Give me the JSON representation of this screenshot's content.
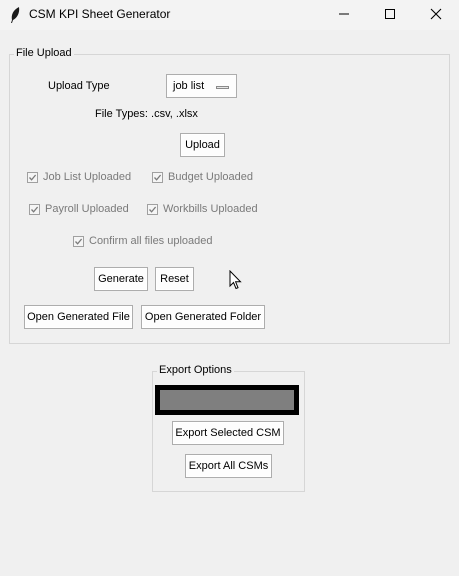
{
  "window": {
    "title": "CSM KPI Sheet Generator",
    "minimize_icon": "minimize-icon",
    "maximize_icon": "maximize-icon",
    "close_icon": "close-icon",
    "app_icon": "feather-icon"
  },
  "file_upload": {
    "frame_label": "File Upload",
    "upload_type_label": "Upload Type",
    "upload_type_value": "job list",
    "file_types_text": "File Types: .csv, .xlsx",
    "upload_button": "Upload",
    "checkboxes": {
      "job_list": {
        "label": "Job List Uploaded",
        "checked": true,
        "disabled": true
      },
      "budget": {
        "label": "Budget Uploaded",
        "checked": true,
        "disabled": true
      },
      "payroll": {
        "label": "Payroll Uploaded",
        "checked": true,
        "disabled": true
      },
      "workbills": {
        "label": "Workbills Uploaded",
        "checked": true,
        "disabled": true
      },
      "confirm": {
        "label": "Confirm all files uploaded",
        "checked": true,
        "disabled": true
      }
    },
    "generate_button": "Generate",
    "reset_button": "Reset",
    "open_file_button": "Open Generated File",
    "open_folder_button": "Open Generated Folder"
  },
  "export_options": {
    "frame_label": "Export Options",
    "csm_select_value": "",
    "export_selected_button": "Export Selected CSM",
    "export_all_button": "Export All CSMs"
  },
  "colors": {
    "window_bg": "#f0f0f0",
    "disabled_text": "#7a7a7a",
    "combo_fill": "#7f7f7f",
    "combo_border": "#000000"
  }
}
